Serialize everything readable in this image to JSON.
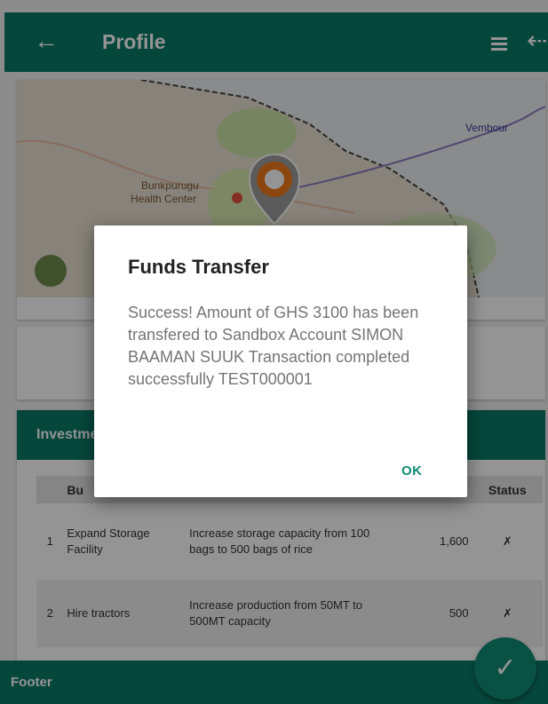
{
  "appbar": {
    "title": "Profile"
  },
  "map": {
    "labels": {
      "place1": "Bunkpurugu",
      "place2": "Health Center",
      "place3": "Vembour"
    }
  },
  "investments": {
    "header": "Investments",
    "columns": [
      "",
      "Bu",
      "",
      "",
      "Status"
    ],
    "rows": [
      {
        "num": "1",
        "name": "Expand Storage Facility",
        "desc": "Increase storage capacity from 100 bags to 500 bags of rice",
        "amount": "1,600",
        "status": "✗"
      },
      {
        "num": "2",
        "name": "Hire tractors",
        "desc": "Increase production from 50MT to 500MT capacity",
        "amount": "500",
        "status": "✗"
      }
    ]
  },
  "footer": {
    "label": "Footer"
  },
  "dialog": {
    "title": "Funds Transfer",
    "message": "Success! Amount of GHS 3100 has been transfered to Sandbox Account SIMON BAAMAN SUUK Transaction completed successfully TEST000001",
    "ok_label": "OK"
  },
  "colors": {
    "primary": "#0b7a66",
    "accent": "#0e8c74"
  },
  "icons": {
    "back": "arrow-left-icon",
    "menu": "menu-icon",
    "logout": "logout-icon",
    "fab": "check-icon",
    "pin": "map-pin-icon"
  }
}
